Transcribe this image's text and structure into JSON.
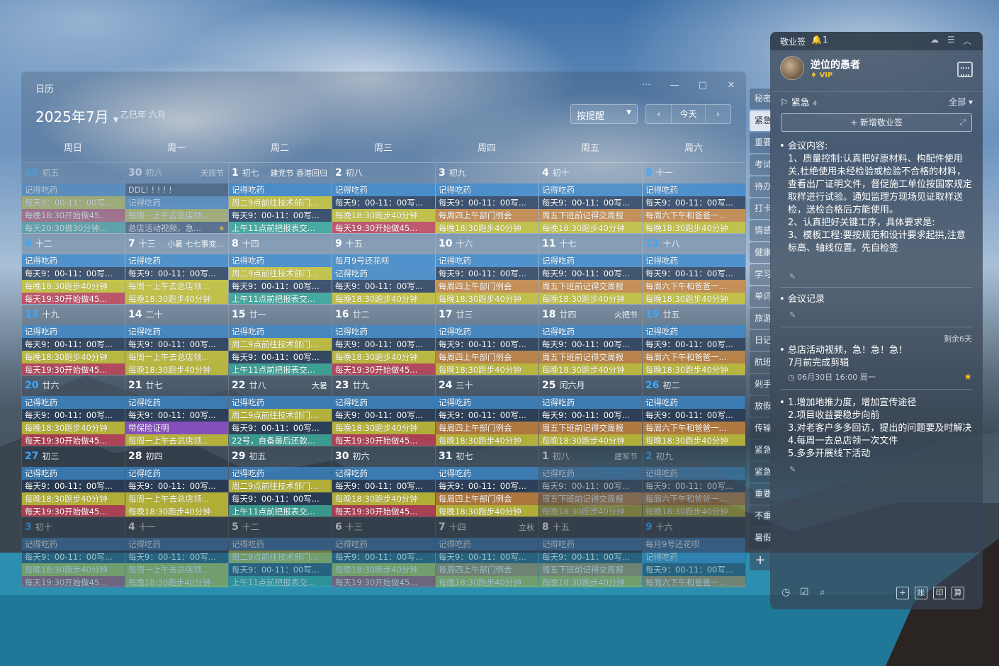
{
  "calendar": {
    "window_title": "日历",
    "month_title": "2025年7月",
    "lunar_header": "乙巳年 六月",
    "remind_select": "按提醒",
    "prev": "‹",
    "today": "今天",
    "next": "›",
    "win_more": "···",
    "win_min": "—",
    "win_max": "□",
    "win_close": "✕",
    "weekdays": [
      "周日",
      "周一",
      "周二",
      "周三",
      "周四",
      "周五",
      "周六"
    ],
    "weeks": [
      [
        {
          "n": "29",
          "lunar": "初五",
          "blue": true,
          "dim": true,
          "events": [
            [
              "记得吃药",
              "blue"
            ],
            [
              "每天9：00-11：00写...",
              "yel"
            ],
            [
              "每晚18:30开始做45...",
              "red"
            ],
            [
              "每天20:30做30分钟...",
              "teal"
            ]
          ]
        },
        {
          "n": "30",
          "lunar": "初六",
          "fest": "天观节",
          "dim": true,
          "events": [
            [
              "DDL! ! ! ! !",
              "navy"
            ],
            [
              "记得吃药",
              "blue"
            ],
            [
              "每周一上午去总店领...",
              "yel"
            ],
            [
              "总店活动视频，急...",
              "navy",
              "star"
            ]
          ]
        },
        {
          "n": "1",
          "lunar": "初七",
          "fest": "建党节 香港回归",
          "events": [
            [
              "记得吃药",
              "blue"
            ],
            [
              "周二9点前往技术部门...",
              "yel"
            ],
            [
              "每天9：00-11：00写...",
              "navy"
            ],
            [
              "上午11点前把报表交...",
              "teal"
            ]
          ]
        },
        {
          "n": "2",
          "lunar": "初八",
          "events": [
            [
              "记得吃药",
              "blue"
            ],
            [
              "每天9：00-11：00写...",
              "navy"
            ],
            [
              "每晚18:30跑步40分钟",
              "yel"
            ],
            [
              "每天19:30开始做45...",
              "red"
            ]
          ]
        },
        {
          "n": "3",
          "lunar": "初九",
          "events": [
            [
              "记得吃药",
              "blue"
            ],
            [
              "每天9：00-11：00写...",
              "navy"
            ],
            [
              "每周四上午部门例会",
              "org"
            ],
            [
              "每晚18:30跑步40分钟",
              "yel"
            ]
          ]
        },
        {
          "n": "4",
          "lunar": "初十",
          "events": [
            [
              "记得吃药",
              "blue"
            ],
            [
              "每天9：00-11：00写...",
              "navy"
            ],
            [
              "周五下班前记得交周报",
              "org"
            ],
            [
              "每晚18:30跑步40分钟",
              "yel"
            ]
          ]
        },
        {
          "n": "5",
          "lunar": "十一",
          "blue": true,
          "events": [
            [
              "记得吃药",
              "blue"
            ],
            [
              "每天9：00-11：00写...",
              "navy"
            ],
            [
              "每周六下午和爸爸一...",
              "org"
            ],
            [
              "每晚18:30跑步40分钟",
              "yel"
            ]
          ]
        }
      ],
      [
        {
          "n": "6",
          "lunar": "十二",
          "blue": true,
          "events": [
            [
              "记得吃药",
              "blue"
            ],
            [
              "每天9：00-11：00写...",
              "navy"
            ],
            [
              "每晚18:30跑步40分钟",
              "yel"
            ],
            [
              "每天19:30开始做45...",
              "red"
            ]
          ]
        },
        {
          "n": "7",
          "lunar": "十三",
          "fest": "小暑 七七事变...",
          "events": [
            [
              "记得吃药",
              "blue"
            ],
            [
              "每天9：00-11：00写...",
              "navy"
            ],
            [
              "每周一上午去总店领...",
              "yel"
            ],
            [
              "每晚18:30跑步40分钟",
              "yel"
            ]
          ]
        },
        {
          "n": "8",
          "lunar": "十四",
          "events": [
            [
              "记得吃药",
              "blue"
            ],
            [
              "周二9点前往技术部门...",
              "yel"
            ],
            [
              "每天9：00-11：00写...",
              "navy"
            ],
            [
              "上午11点前把报表交...",
              "teal"
            ]
          ]
        },
        {
          "n": "9",
          "lunar": "十五",
          "events": [
            [
              "每月9号还花呗",
              "blue"
            ],
            [
              "记得吃药",
              "blue"
            ],
            [
              "每天9：00-11：00写...",
              "navy"
            ],
            [
              "每晚18:30跑步40分钟",
              "yel"
            ]
          ]
        },
        {
          "n": "10",
          "lunar": "十六",
          "events": [
            [
              "记得吃药",
              "blue"
            ],
            [
              "每天9：00-11：00写...",
              "navy"
            ],
            [
              "每周四上午部门例会",
              "org"
            ],
            [
              "每晚18:30跑步40分钟",
              "yel"
            ]
          ]
        },
        {
          "n": "11",
          "lunar": "十七",
          "events": [
            [
              "记得吃药",
              "blue"
            ],
            [
              "每天9：00-11：00写...",
              "navy"
            ],
            [
              "周五下班前记得交周报",
              "org"
            ],
            [
              "每晚18:30跑步40分钟",
              "yel"
            ]
          ]
        },
        {
          "n": "12",
          "lunar": "十八",
          "blue": true,
          "events": [
            [
              "记得吃药",
              "blue"
            ],
            [
              "每天9：00-11：00写...",
              "navy"
            ],
            [
              "每周六下午和爸爸一...",
              "org"
            ],
            [
              "每晚18:30跑步40分钟",
              "yel"
            ]
          ]
        }
      ],
      [
        {
          "n": "13",
          "lunar": "十九",
          "blue": true,
          "events": [
            [
              "记得吃药",
              "blue"
            ],
            [
              "每天9：00-11：00写...",
              "navy"
            ],
            [
              "每晚18:30跑步40分钟",
              "yel"
            ],
            [
              "每天19:30开始做45...",
              "red"
            ]
          ]
        },
        {
          "n": "14",
          "lunar": "二十",
          "events": [
            [
              "记得吃药",
              "blue"
            ],
            [
              "每天9：00-11：00写...",
              "navy"
            ],
            [
              "每周一上午去总店领...",
              "yel"
            ],
            [
              "每晚18:30跑步40分钟",
              "yel"
            ]
          ]
        },
        {
          "n": "15",
          "lunar": "廿一",
          "events": [
            [
              "记得吃药",
              "blue"
            ],
            [
              "周二9点前往技术部门...",
              "yel"
            ],
            [
              "每天9：00-11：00写...",
              "navy"
            ],
            [
              "上午11点前把报表交...",
              "teal"
            ]
          ]
        },
        {
          "n": "16",
          "lunar": "廿二",
          "events": [
            [
              "记得吃药",
              "blue"
            ],
            [
              "每天9：00-11：00写...",
              "navy"
            ],
            [
              "每晚18:30跑步40分钟",
              "yel"
            ],
            [
              "每天19:30开始做45...",
              "red"
            ]
          ]
        },
        {
          "n": "17",
          "lunar": "廿三",
          "events": [
            [
              "记得吃药",
              "blue"
            ],
            [
              "每天9：00-11：00写...",
              "navy"
            ],
            [
              "每周四上午部门例会",
              "org"
            ],
            [
              "每晚18:30跑步40分钟",
              "yel"
            ]
          ]
        },
        {
          "n": "18",
          "lunar": "廿四",
          "fest": "火把节",
          "events": [
            [
              "记得吃药",
              "blue"
            ],
            [
              "每天9：00-11：00写...",
              "navy"
            ],
            [
              "周五下班前记得交周报",
              "org"
            ],
            [
              "每晚18:30跑步40分钟",
              "yel"
            ]
          ]
        },
        {
          "n": "19",
          "lunar": "廿五",
          "blue": true,
          "events": [
            [
              "记得吃药",
              "blue"
            ],
            [
              "每天9：00-11：00写...",
              "navy"
            ],
            [
              "每周六下午和爸爸一...",
              "org"
            ],
            [
              "每晚18:30跑步40分钟",
              "yel"
            ]
          ]
        }
      ],
      [
        {
          "n": "20",
          "lunar": "廿六",
          "blue": true,
          "events": [
            [
              "记得吃药",
              "blue"
            ],
            [
              "每天9：00-11：00写...",
              "navy"
            ],
            [
              "每晚18:30跑步40分钟",
              "yel"
            ],
            [
              "每天19:30开始做45...",
              "red"
            ]
          ]
        },
        {
          "n": "21",
          "lunar": "廿七",
          "events": [
            [
              "记得吃药",
              "blue"
            ],
            [
              "每天9：00-11：00写...",
              "navy"
            ],
            [
              "带保险证明",
              "pur"
            ],
            [
              "每周一上午去总店领...",
              "yel"
            ]
          ]
        },
        {
          "n": "22",
          "lunar": "廿八",
          "fest": "大暑",
          "events": [
            [
              "记得吃药",
              "blue"
            ],
            [
              "周二9点前往技术部门...",
              "yel"
            ],
            [
              "每天9：00-11：00写...",
              "navy"
            ],
            [
              "22号，自备最后还款...",
              "teal"
            ]
          ]
        },
        {
          "n": "23",
          "lunar": "廿九",
          "events": [
            [
              "记得吃药",
              "blue"
            ],
            [
              "每天9：00-11：00写...",
              "navy"
            ],
            [
              "每晚18:30跑步40分钟",
              "yel"
            ],
            [
              "每天19:30开始做45...",
              "red"
            ]
          ]
        },
        {
          "n": "24",
          "lunar": "三十",
          "events": [
            [
              "记得吃药",
              "blue"
            ],
            [
              "每天9：00-11：00写...",
              "navy"
            ],
            [
              "每周四上午部门例会",
              "org"
            ],
            [
              "每晚18:30跑步40分钟",
              "yel"
            ]
          ]
        },
        {
          "n": "25",
          "lunar": "闰六月",
          "events": [
            [
              "记得吃药",
              "blue"
            ],
            [
              "每天9：00-11：00写...",
              "navy"
            ],
            [
              "周五下班前记得交周报",
              "org"
            ],
            [
              "每晚18:30跑步40分钟",
              "yel"
            ]
          ]
        },
        {
          "n": "26",
          "lunar": "初二",
          "blue": true,
          "events": [
            [
              "记得吃药",
              "blue"
            ],
            [
              "每天9：00-11：00写...",
              "navy"
            ],
            [
              "每周六下午和爸爸一...",
              "org"
            ],
            [
              "每晚18:30跑步40分钟",
              "yel"
            ]
          ]
        }
      ],
      [
        {
          "n": "27",
          "lunar": "初三",
          "blue": true,
          "events": [
            [
              "记得吃药",
              "blue"
            ],
            [
              "每天9：00-11：00写...",
              "navy"
            ],
            [
              "每晚18:30跑步40分钟",
              "yel"
            ],
            [
              "每天19:30开始做45...",
              "red"
            ]
          ]
        },
        {
          "n": "28",
          "lunar": "初四",
          "events": [
            [
              "记得吃药",
              "blue"
            ],
            [
              "每天9：00-11：00写...",
              "navy"
            ],
            [
              "每周一上午去总店领...",
              "yel"
            ],
            [
              "每晚18:30跑步40分钟",
              "yel"
            ]
          ]
        },
        {
          "n": "29",
          "lunar": "初五",
          "events": [
            [
              "记得吃药",
              "blue"
            ],
            [
              "周二9点前往技术部门...",
              "yel"
            ],
            [
              "每天9：00-11：00写...",
              "navy"
            ],
            [
              "上午11点前把报表交...",
              "teal"
            ]
          ]
        },
        {
          "n": "30",
          "lunar": "初六",
          "events": [
            [
              "记得吃药",
              "blue"
            ],
            [
              "每天9：00-11：00写...",
              "navy"
            ],
            [
              "每晚18:30跑步40分钟",
              "yel"
            ],
            [
              "每天19:30开始做45...",
              "red"
            ]
          ]
        },
        {
          "n": "31",
          "lunar": "初七",
          "events": [
            [
              "记得吃药",
              "blue"
            ],
            [
              "每天9：00-11：00写...",
              "navy"
            ],
            [
              "每周四上午部门例会",
              "org"
            ],
            [
              "每晚18:30跑步40分钟",
              "yel"
            ]
          ]
        },
        {
          "n": "1",
          "lunar": "初八",
          "fest": "建军节",
          "dim": true,
          "events": [
            [
              "记得吃药",
              "blue"
            ],
            [
              "每天9：00-11：00写...",
              "navy"
            ],
            [
              "周五下班前记得交周报",
              "org"
            ],
            [
              "每晚18:30跑步40分钟",
              "yel"
            ]
          ]
        },
        {
          "n": "2",
          "lunar": "初九",
          "blue": true,
          "dim": true,
          "events": [
            [
              "记得吃药",
              "blue"
            ],
            [
              "每天9：00-11：00写...",
              "navy"
            ],
            [
              "每周六下午和爸爸一...",
              "org"
            ],
            [
              "每晚18:30跑步40分钟",
              "yel"
            ]
          ]
        }
      ],
      [
        {
          "n": "3",
          "lunar": "初十",
          "blue": true,
          "dim": true,
          "events": [
            [
              "记得吃药",
              "blue"
            ],
            [
              "每天9：00-11：00写...",
              "navy"
            ],
            [
              "每晚18:30跑步40分钟",
              "yel"
            ],
            [
              "每天19:30开始做45...",
              "red"
            ]
          ]
        },
        {
          "n": "4",
          "lunar": "十一",
          "dim": true,
          "events": [
            [
              "记得吃药",
              "blue"
            ],
            [
              "每天9：00-11：00写...",
              "navy"
            ],
            [
              "每周一上午去总店领...",
              "yel"
            ],
            [
              "每晚18:30跑步40分钟",
              "yel"
            ]
          ]
        },
        {
          "n": "5",
          "lunar": "十二",
          "dim": true,
          "events": [
            [
              "记得吃药",
              "blue"
            ],
            [
              "周二9点前往技术部门...",
              "yel"
            ],
            [
              "每天9：00-11：00写...",
              "navy"
            ],
            [
              "上午11点前把报表交...",
              "teal"
            ]
          ]
        },
        {
          "n": "6",
          "lunar": "十三",
          "dim": true,
          "events": [
            [
              "记得吃药",
              "blue"
            ],
            [
              "每天9：00-11：00写...",
              "navy"
            ],
            [
              "每晚18:30跑步40分钟",
              "yel"
            ],
            [
              "每天19:30开始做45...",
              "red"
            ]
          ]
        },
        {
          "n": "7",
          "lunar": "十四",
          "fest": "立秋",
          "dim": true,
          "events": [
            [
              "记得吃药",
              "blue"
            ],
            [
              "每天9：00-11：00写...",
              "navy"
            ],
            [
              "每周四上午部门例会",
              "org"
            ],
            [
              "每晚18:30跑步40分钟",
              "yel"
            ]
          ]
        },
        {
          "n": "8",
          "lunar": "十五",
          "dim": true,
          "events": [
            [
              "记得吃药",
              "blue"
            ],
            [
              "每天9：00-11：00写...",
              "navy"
            ],
            [
              "周五下班前记得交周报",
              "org"
            ],
            [
              "每晚18:30跑步40分钟",
              "yel"
            ]
          ]
        },
        {
          "n": "9",
          "lunar": "十六",
          "blue": true,
          "dim": true,
          "events": [
            [
              "每月9号还花呗",
              "blue"
            ],
            [
              "记得吃药",
              "blue"
            ],
            [
              "每天9：00-11：00写...",
              "navy"
            ],
            [
              "每周六下午和爸爸一...",
              "org"
            ]
          ]
        }
      ]
    ]
  },
  "tabs": [
    "秘密",
    "紧急",
    "重要",
    "考试",
    "待办",
    "打卡",
    "情感",
    "健康",
    "学习",
    "单词",
    "旅游",
    "日记",
    "航班",
    "剁手",
    "放假",
    "传输",
    "紧急",
    "紧急",
    "重要",
    "不重",
    "暑假"
  ],
  "tabs_plus": "+",
  "notes": {
    "app_name": "敬业签",
    "bell_count": "1",
    "user_name": "逆位的愚者",
    "vip": "VIP",
    "category": "紧急",
    "category_count": "4",
    "filter": "全部",
    "new_btn": "+ 新增敬业签",
    "memos": [
      {
        "text": "会议内容:\n1、质量控制:认真把好原材料、构配件使用关,杜绝使用未经检验或检验不合格的材料，查看出厂证明文件，督促施工单位按国家规定取样进行试验。通知监理方现场见证取样送检，送检合格后方能使用。\n2、认真把好关键工序，具体要求是:\n3、模板工程:要按规范和设计要求起拱,注意标高、轴线位置。先自检签"
      },
      {
        "text": "会议记录"
      },
      {
        "remain": "剩余6天",
        "text": "总店活动视频，急！急！急！\n7月前完成剪辑",
        "due": "06月30日 16:00 周一"
      },
      {
        "text": "1.增加地推力度，增加宣传途径\n2.项目收益要稳步向前\n3.对老客户多多回访，提出的问题要及时解决\n4.每周一去总店领一次文件\n5.多多开展线下活动"
      }
    ],
    "bottom_buttons": [
      "账",
      "印",
      "算"
    ]
  }
}
